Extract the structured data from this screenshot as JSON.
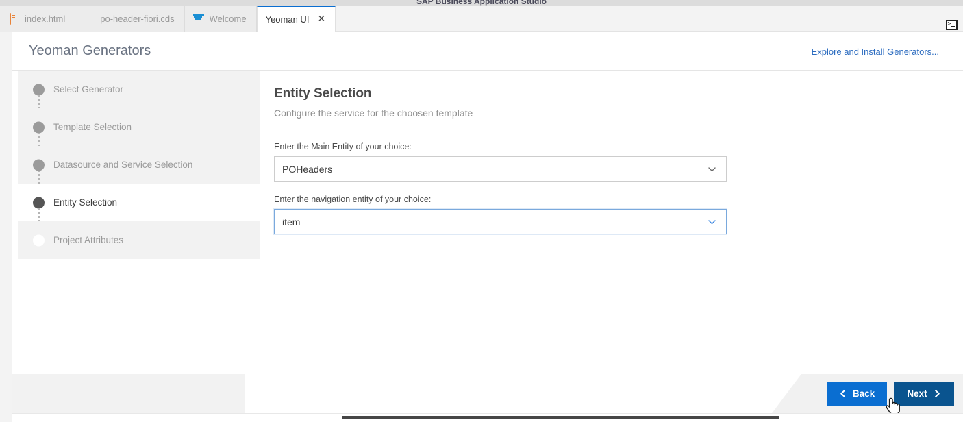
{
  "window": {
    "title": "SAP Business Application Studio"
  },
  "tabbar": {
    "tabs": [
      {
        "label": "index.html",
        "icon": "html5-file-icon",
        "active": false,
        "closable": false
      },
      {
        "label": "po-header-fiori.cds",
        "icon": "file-icon",
        "active": false,
        "closable": false
      },
      {
        "label": "Welcome",
        "icon": "sap-logo-icon",
        "active": false,
        "closable": false
      },
      {
        "label": "Yeoman UI",
        "icon": "none",
        "active": true,
        "closable": true,
        "close_glyph": "✕"
      }
    ],
    "panel_toggle": "terminal-panel-icon"
  },
  "header": {
    "title": "Yeoman Generators",
    "explore_link": "Explore and Install Generators..."
  },
  "sidebar": {
    "steps": [
      {
        "label": "Select Generator",
        "state": "done"
      },
      {
        "label": "Template Selection",
        "state": "done"
      },
      {
        "label": "Datasource and Service Selection",
        "state": "done"
      },
      {
        "label": "Entity Selection",
        "state": "active"
      },
      {
        "label": "Project Attributes",
        "state": "pending"
      }
    ]
  },
  "main": {
    "title": "Entity Selection",
    "subtitle": "Configure the service for the choosen template",
    "fields": [
      {
        "label": "Enter the Main Entity of your choice:",
        "value": "POHeaders",
        "placeholder": "",
        "focused": false,
        "arrow_icon": "chevron-down-icon"
      },
      {
        "label": "Enter the navigation entity of your choice:",
        "value": "item",
        "placeholder": "",
        "focused": true,
        "arrow_icon": "chevron-down-icon"
      }
    ]
  },
  "footer": {
    "back_label": "Back",
    "next_label": "Next",
    "back_icon": "chevron-left-icon",
    "next_icon": "chevron-right-icon"
  },
  "colors": {
    "accent_blue": "#0a6ed1",
    "accent_blue_active": "#0a548f",
    "link_blue": "#2b6bbf",
    "focus_border": "#7aa9dd",
    "step_done": "#9b9b9b",
    "step_active": "#555555",
    "sidebar_row": "#f2f2f2"
  },
  "scrollbar": {
    "orientation": "horizontal",
    "position_label": ""
  }
}
